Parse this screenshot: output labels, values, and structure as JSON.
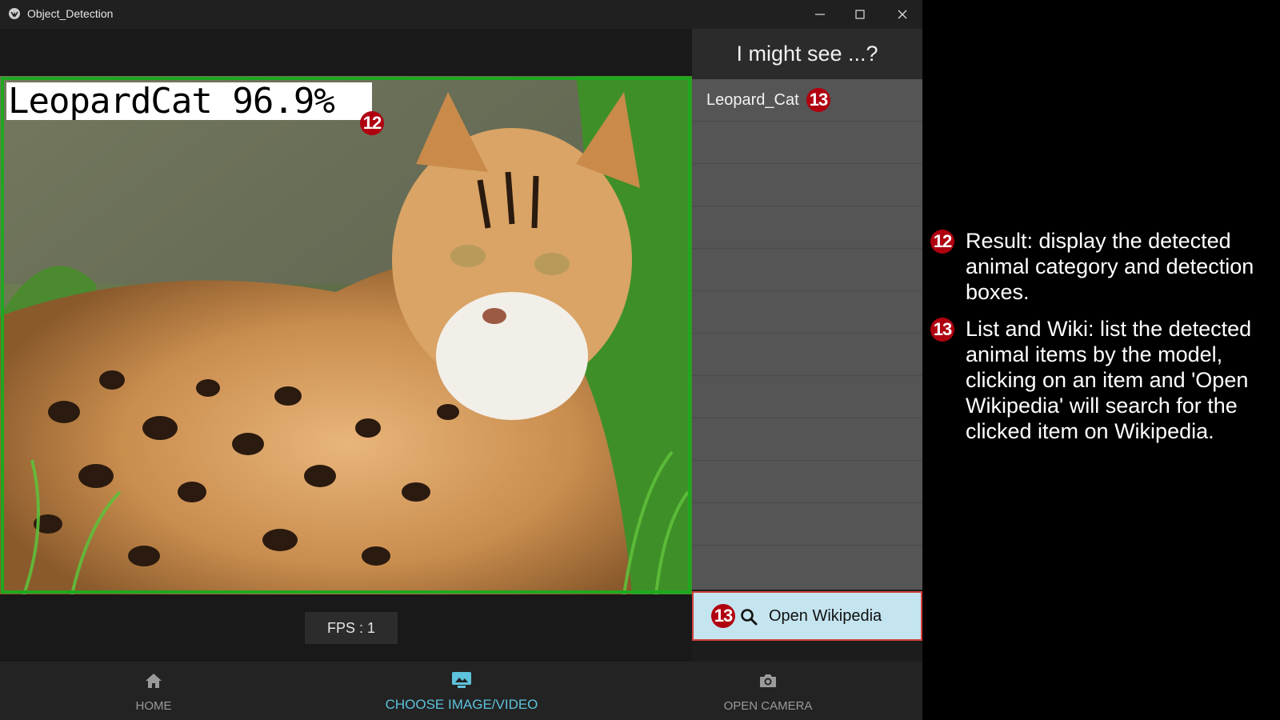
{
  "window": {
    "title": "Object_Detection"
  },
  "detection": {
    "label": "LeopardCat 96.9%",
    "badge": "12"
  },
  "fps": {
    "text": "FPS : 1"
  },
  "results_panel": {
    "header": "I might see ...?",
    "items": [
      {
        "label": "Leopard_Cat",
        "badge": "13"
      }
    ],
    "wiki_button": {
      "label": "Open Wikipedia",
      "badge": "13",
      "icon": "search-icon"
    }
  },
  "nav": {
    "items": [
      {
        "label": "HOME",
        "icon": "home-icon"
      },
      {
        "label": "CHOOSE IMAGE/VIDEO",
        "icon": "image-icon",
        "active": true
      },
      {
        "label": "OPEN CAMERA",
        "icon": "camera-icon"
      }
    ]
  },
  "annotations": [
    {
      "badge": "12",
      "text": "Result: display the detected animal category and detection boxes."
    },
    {
      "badge": "13",
      "text": "List and Wiki: list the detected animal items by the model, clicking on an item and 'Open Wikipedia' will search for the clicked item on Wikipedia."
    }
  ],
  "colors": {
    "accent": "#5ec2dc",
    "box": "#1fa81f",
    "badge": "#b00010",
    "wiki_bg": "#c4e4ef"
  }
}
